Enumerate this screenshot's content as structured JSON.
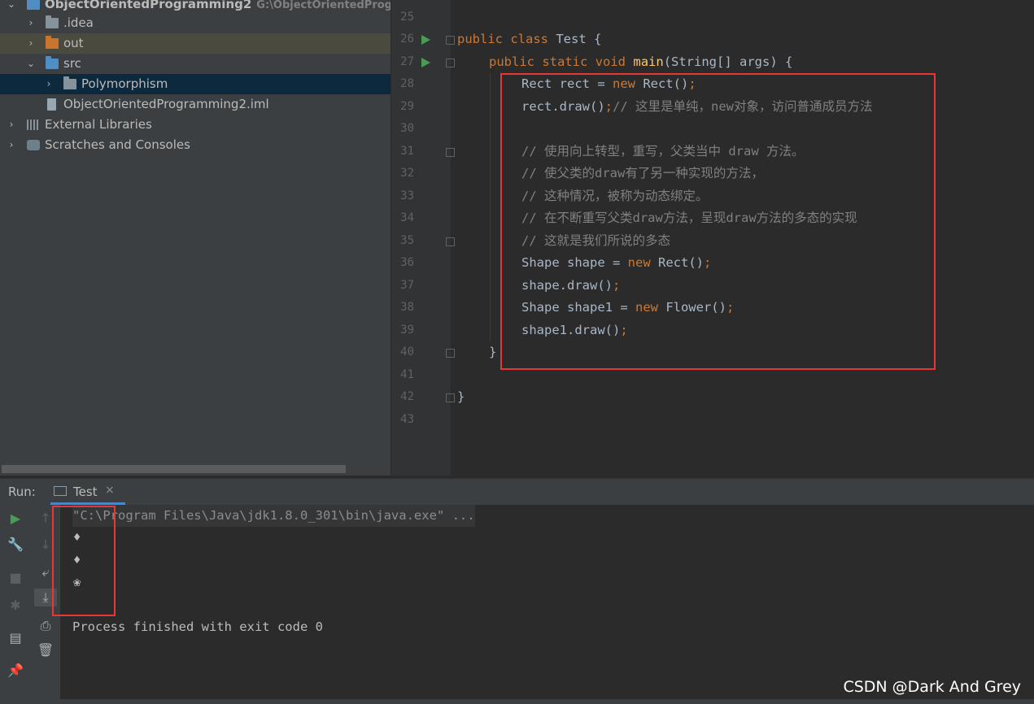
{
  "project": {
    "rows": [
      {
        "label": "ObjectOrientedProgramming2",
        "path": "G:\\ObjectOrientedProgran"
      },
      {
        "label": ".idea"
      },
      {
        "label": "out"
      },
      {
        "label": "src"
      },
      {
        "label": "Polymorphism"
      },
      {
        "label": "ObjectOrientedProgramming2.iml"
      },
      {
        "label": "External Libraries"
      },
      {
        "label": "Scratches and Consoles"
      }
    ]
  },
  "editor": {
    "line_numbers": [
      "25",
      "26",
      "27",
      "28",
      "29",
      "30",
      "31",
      "32",
      "33",
      "34",
      "35",
      "36",
      "37",
      "38",
      "39",
      "40",
      "41",
      "42",
      "43"
    ],
    "lines": {
      "l26": {
        "kw1": "public",
        "kw2": "class",
        "rest": " Test {"
      },
      "l27": {
        "kw1": "public",
        "kw2": "static",
        "kw3": "void",
        "fn": "main",
        "rest": "(String[] args) {"
      },
      "l28": {
        "a": "Rect rect = ",
        "kw": "new",
        "b": " Rect()",
        "semi": ";"
      },
      "l29": {
        "a": "rect.draw()",
        "semi": ";",
        "cm": "// 这里是单纯，new对象，访问普通成员方法"
      },
      "l31": "// 使用向上转型，重写，父类当中 draw 方法。",
      "l32": "// 使父类的draw有了另一种实现的方法，",
      "l33": "// 这种情况，被称为动态绑定。",
      "l34": "// 在不断重写父类draw方法，呈现draw方法的多态的实现",
      "l35": "// 这就是我们所说的多态",
      "l36": {
        "a": "Shape shape = ",
        "kw": "new",
        "b": " Rect()",
        "semi": ";"
      },
      "l37": {
        "a": "shape.draw()",
        "semi": ";"
      },
      "l38": {
        "a": "Shape shape1 = ",
        "kw": "new",
        "b": " Flower()",
        "semi": ";"
      },
      "l39": {
        "a": "shape1.draw()",
        "semi": ";"
      },
      "l40": "}",
      "l42": "}"
    }
  },
  "run": {
    "label": "Run:",
    "tab": "Test",
    "tab_close": "×",
    "console": [
      "\"C:\\Program Files\\Java\\jdk1.8.0_301\\bin\\java.exe\" ...",
      "♦",
      "♦",
      "❀",
      "",
      "Process finished with exit code 0"
    ]
  },
  "watermark": "CSDN @Dark And Grey"
}
